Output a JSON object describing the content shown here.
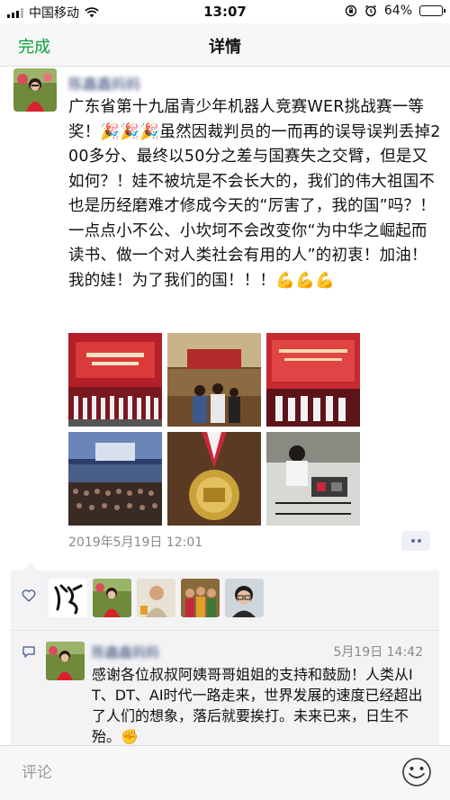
{
  "status": {
    "carrier": "中国移动",
    "time": "13:07",
    "battery_percent": "64%",
    "battery_level": 0.64
  },
  "nav": {
    "done_label": "完成",
    "title": "详情"
  },
  "post": {
    "author": "陈鑫鑫妈妈",
    "text": "广东省第十九届青少年机器人竞赛WER挑战赛一等奖！🎉🎉🎉虽然因裁判员的一而再的误导误判丢掉200多分、最终以50分之差与国赛失之交臂，但是又如何？！娃不被坑是不会长大的，我们的伟大祖国不也是历经磨难才修成今天的“厉害了，我的国”吗？！一点点小不公、小坎坷不会改变你“为中华之崛起而读书、做一个对人类社会有用的人”的初衷！加油！我的娃！为了我们的国！！！💪💪💪",
    "date": "2019年5月19日 12:01",
    "photos": [
      "stage-banner-photo",
      "auditorium-photo",
      "award-ceremony-photo",
      "audience-hall-photo",
      "gold-medal-photo",
      "robot-building-photo"
    ]
  },
  "likes": {
    "avatars": [
      "calligraphy-avatar",
      "woman-field-avatar",
      "child-avatar",
      "group-avatar",
      "boy-glasses-avatar"
    ]
  },
  "comment": {
    "author": "陈鑫鑫妈妈",
    "time": "5月19日 14:42",
    "text": "感谢各位叔叔阿姨哥哥姐姐的支持和鼓励！人类从IT、DT、AI时代一路走来，世界发展的速度已经超出了人们的想象，落后就要挨打。未来已来，日生不殆。✊"
  },
  "input": {
    "placeholder": "评论"
  },
  "colors": {
    "accent_green": "#07a23a",
    "link_blue": "#5b6a91",
    "panel_bg": "#f3f3f5"
  }
}
